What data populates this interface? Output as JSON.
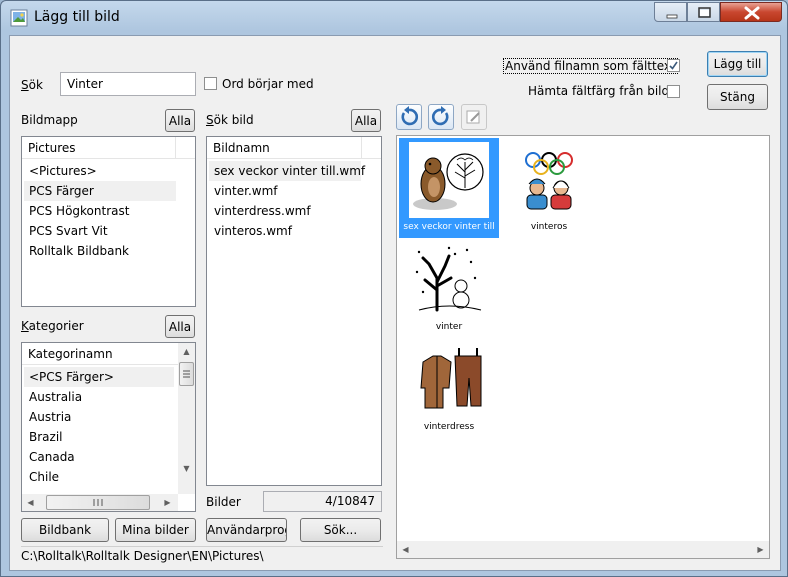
{
  "window": {
    "title": "Lägg till bild"
  },
  "search": {
    "label": "Sök",
    "value": "Vinter",
    "starts_with_label": "Ord börjar med",
    "starts_with_checked": false
  },
  "options": {
    "use_filename_label": "Använd filnamn som fälttext",
    "use_filename_checked": true,
    "fetch_color_label": "Hämta fältfärg från bild",
    "fetch_color_checked": false
  },
  "buttons": {
    "add": "Lägg till",
    "close": "Stäng",
    "all": "Alla",
    "bildbank": "Bildbank",
    "mina_bilder": "Mina bilder",
    "anvandarprog": "Användarprog",
    "sok": "Sök..."
  },
  "bildmapp": {
    "label": "Bildmapp",
    "header": "Pictures",
    "items": [
      "<Pictures>",
      "PCS Färger",
      "PCS Högkontrast",
      "PCS Svart Vit",
      "Rolltalk Bildbank"
    ],
    "selected": 1
  },
  "sok_bild": {
    "label": "Sök bild",
    "header": "Bildnamn",
    "items": [
      "sex veckor vinter till.wmf",
      "vinter.wmf",
      "vinterdress.wmf",
      "vinteros.wmf"
    ],
    "selected": 0
  },
  "kategorier": {
    "label": "Kategorier",
    "header": "Kategorinamn",
    "items": [
      "<PCS Färger>",
      "Australia",
      "Austria",
      "Brazil",
      "Canada",
      "Chile"
    ],
    "selected": 0
  },
  "bilder": {
    "label": "Bilder",
    "count": "4/10847"
  },
  "path": "C:\\Rolltalk\\Rolltalk Designer\\EN\\Pictures\\",
  "tiles": [
    {
      "caption": "sex veckor vinter till",
      "icon": "groundhog-calendar-icon"
    },
    {
      "caption": "vinteros",
      "icon": "olympic-rings-icon"
    },
    {
      "caption": "vinter",
      "icon": "winter-tree-snowman-icon"
    },
    {
      "caption": "vinterdress",
      "icon": "winter-clothes-icon"
    }
  ],
  "colors": {
    "selection": "#3399ff",
    "accent": "#3c7fb1"
  }
}
